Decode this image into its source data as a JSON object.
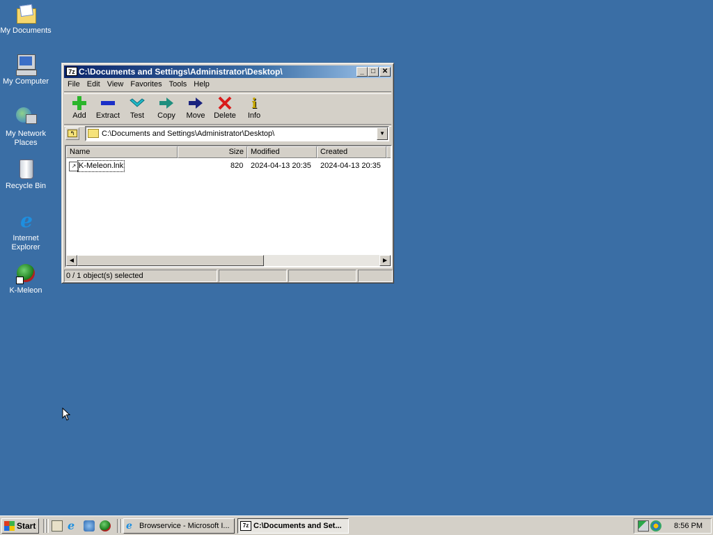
{
  "desktop": {
    "icons": [
      {
        "label": "My Documents"
      },
      {
        "label": "My Computer"
      },
      {
        "label": "My Network Places"
      },
      {
        "label": "Recycle Bin"
      },
      {
        "label": "Internet Explorer"
      },
      {
        "label": "K-Meleon"
      }
    ]
  },
  "window": {
    "app_icon": "7z",
    "title": "C:\\Documents and Settings\\Administrator\\Desktop\\",
    "menu": [
      "File",
      "Edit",
      "View",
      "Favorites",
      "Tools",
      "Help"
    ],
    "toolbar": [
      {
        "label": "Add",
        "icon": "plus-icon",
        "color": "#2bb52b"
      },
      {
        "label": "Extract",
        "icon": "minus-icon",
        "color": "#1a2fc8"
      },
      {
        "label": "Test",
        "icon": "checkmark-icon",
        "color": "#20b8c8"
      },
      {
        "label": "Copy",
        "icon": "arrow-right-icon",
        "color": "#1f8f7f"
      },
      {
        "label": "Move",
        "icon": "arrow-right-icon",
        "color": "#1a237e"
      },
      {
        "label": "Delete",
        "icon": "x-icon",
        "color": "#d91b1b"
      },
      {
        "label": "Info",
        "icon": "info-icon",
        "color": "#c8a800"
      }
    ],
    "address": "C:\\Documents and Settings\\Administrator\\Desktop\\",
    "columns": [
      "Name",
      "Size",
      "Modified",
      "Created"
    ],
    "files": [
      {
        "name": "K-Meleon.lnk",
        "size": "820",
        "modified": "2024-04-13 20:35",
        "created": "2024-04-13 20:35"
      }
    ],
    "status": "0 / 1 object(s) selected"
  },
  "taskbar": {
    "start": "Start",
    "tasks": [
      {
        "label": "Browservice - Microsoft I...",
        "active": false
      },
      {
        "label": "C:\\Documents and Set...",
        "active": true
      }
    ],
    "clock": "8:56 PM"
  }
}
